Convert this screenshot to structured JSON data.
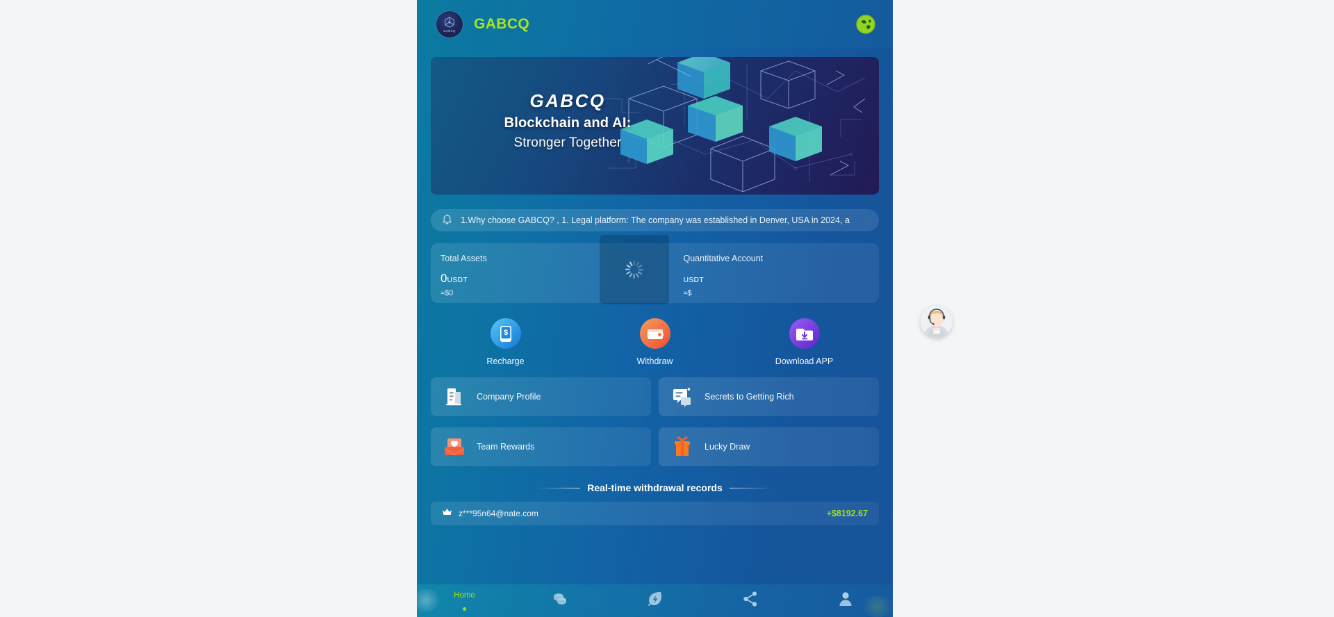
{
  "header": {
    "brand": "GABCQ",
    "logo_icon": "gabcq-cube-logo",
    "logo_caption": "GABCQ",
    "lang_icon": "globe-icon",
    "brand_color": "#a9e619"
  },
  "banner": {
    "icon": "blockchain-cubes-illustration",
    "line1": "GABCQ",
    "line2": "Blockchain and AI:",
    "line3": "Stronger Together"
  },
  "notice": {
    "icon": "bell-icon",
    "text": "1.Why choose GABCQ? , 1. Legal platform: The company was established in Denver, USA in 2024, a"
  },
  "assets": {
    "total": {
      "label": "Total Assets",
      "amount": "0",
      "unit": "USDT",
      "approx": "≈$0"
    },
    "quantitative": {
      "label": "Quantitative Account",
      "amount": "",
      "unit": "USDT",
      "approx": "≈$",
      "loading": true,
      "spinner_icon": "loading-spinner-icon"
    }
  },
  "quick_actions": [
    {
      "label": "Recharge",
      "icon": "recharge-phone-dollar-icon",
      "color": "#1e9ae8"
    },
    {
      "label": "Withdraw",
      "icon": "withdraw-wallet-icon",
      "color": "#f2663c"
    },
    {
      "label": "Download APP",
      "icon": "download-app-icon",
      "color": "#7b3ff2"
    }
  ],
  "menu_cards": [
    {
      "label": "Company Profile",
      "icon": "company-building-icon"
    },
    {
      "label": "Secrets to Getting Rich",
      "icon": "chat-bubbles-icon"
    },
    {
      "label": "Team Rewards",
      "icon": "envelope-heart-icon"
    },
    {
      "label": "Lucky Draw",
      "icon": "gift-box-icon"
    }
  ],
  "records": {
    "title": "Real-time withdrawal records",
    "items": [
      {
        "icon": "crown-icon",
        "user": "z***95n64@nate.com",
        "amount": "+$8192.67"
      }
    ],
    "amount_color": "#9fe01c"
  },
  "nav": [
    {
      "label": "Home",
      "icon": "home-icon",
      "active": true
    },
    {
      "label": "",
      "icon": "coins-icon",
      "active": false
    },
    {
      "label": "",
      "icon": "leaf-bolt-icon",
      "active": false
    },
    {
      "label": "",
      "icon": "share-icon",
      "active": false
    },
    {
      "label": "",
      "icon": "user-person-icon",
      "active": false
    }
  ],
  "support": {
    "icon": "customer-service-agent-avatar"
  }
}
